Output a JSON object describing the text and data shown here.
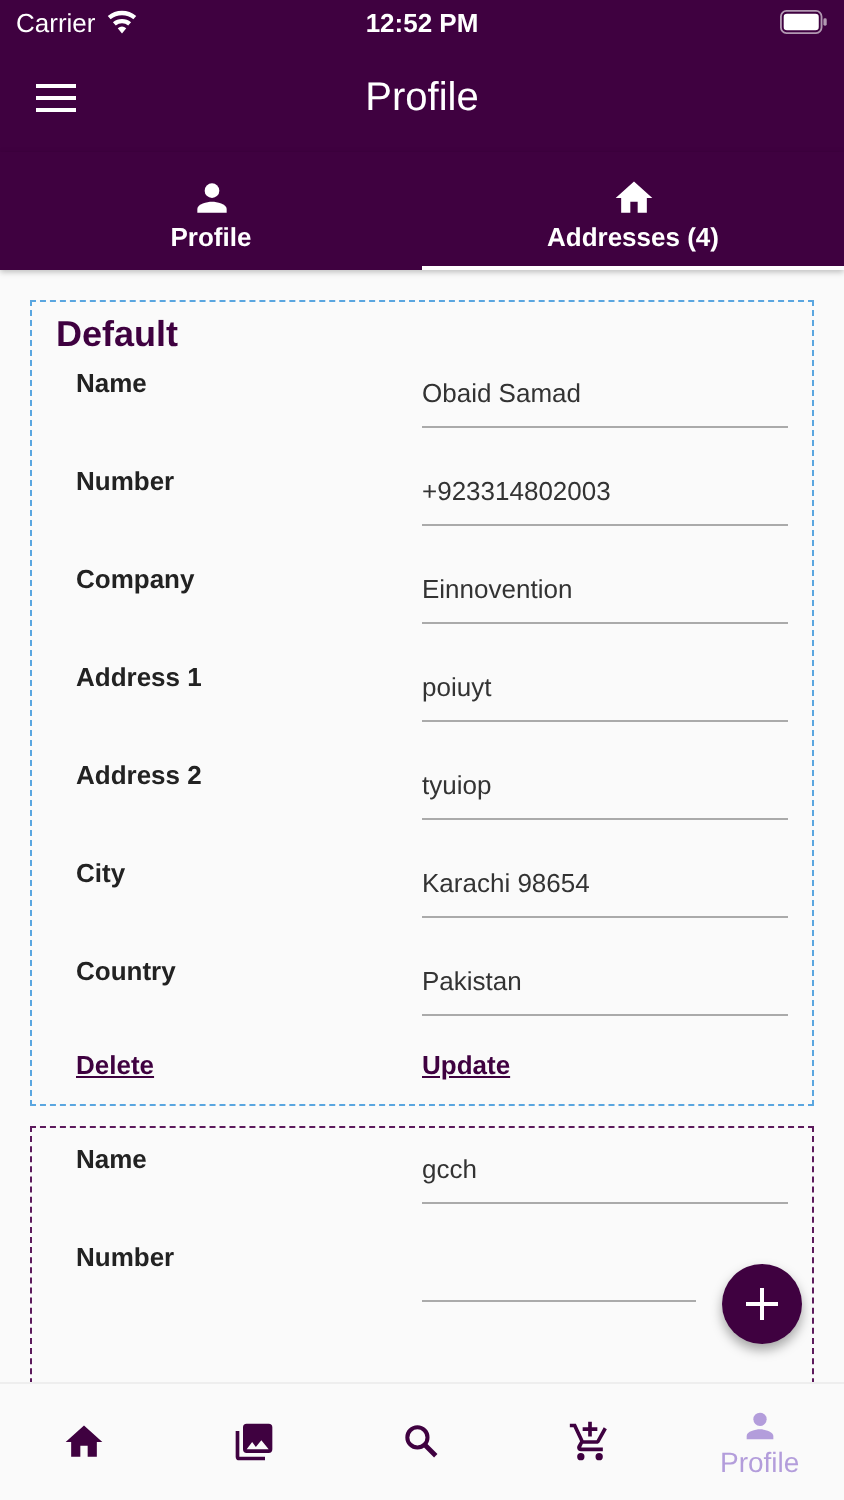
{
  "status_bar": {
    "carrier": "Carrier",
    "time": "12:52 PM"
  },
  "app_bar": {
    "title": "Profile"
  },
  "tabs": [
    {
      "label": "Profile",
      "selected": false
    },
    {
      "label": "Addresses (4)",
      "selected": true
    }
  ],
  "addresses": [
    {
      "default": true,
      "title": "Default",
      "fields": [
        {
          "label": "Name",
          "value": "Obaid Samad"
        },
        {
          "label": "Number",
          "value": "+923314802003"
        },
        {
          "label": "Company",
          "value": "Einnovention"
        },
        {
          "label": "Address 1",
          "value": "poiuyt"
        },
        {
          "label": "Address 2",
          "value": "tyuiop"
        },
        {
          "label": "City",
          "value": "Karachi 98654"
        },
        {
          "label": "Country",
          "value": "Pakistan"
        }
      ],
      "actions": [
        "Delete",
        "Update"
      ]
    },
    {
      "default": false,
      "fields": [
        {
          "label": "Name",
          "value": "gcch"
        },
        {
          "label": "Number"
        }
      ]
    }
  ],
  "bottom_nav": [
    {
      "selected": false
    },
    {
      "selected": false
    },
    {
      "selected": false
    },
    {
      "selected": false
    },
    {
      "selected": true,
      "label": "Profile"
    }
  ]
}
